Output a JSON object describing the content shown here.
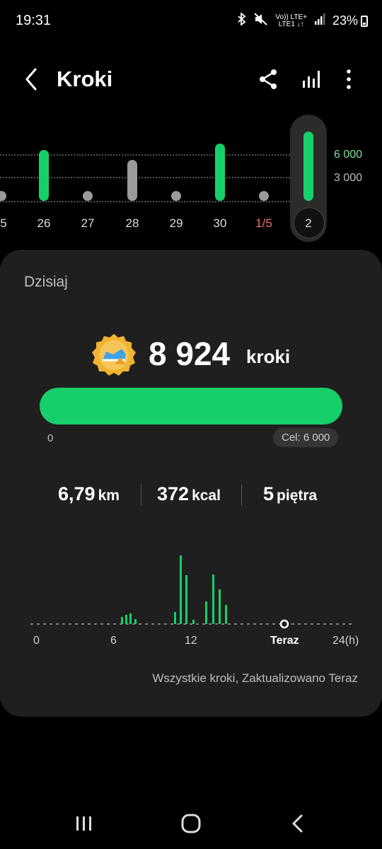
{
  "status_bar": {
    "time": "19:31",
    "network_top": "Vo)) LTE+",
    "network_bottom": "LTE1 ↓↑",
    "battery": "23%"
  },
  "header": {
    "title": "Kroki",
    "icons": [
      "back-icon",
      "share-icon",
      "bar-chart-icon",
      "more-icon"
    ]
  },
  "daily_chart": {
    "y_ticks": [
      "6 000",
      "3 000"
    ],
    "days": [
      "5",
      "26",
      "27",
      "28",
      "29",
      "30",
      "1/5",
      "2"
    ],
    "colors": {
      "goal_met": "#17cf6a",
      "below_goal": "#9a9a9a",
      "accent_red": "#f07070"
    }
  },
  "today": {
    "title": "Dzisiaj",
    "steps": "8 924",
    "steps_unit": "kroki",
    "progress_fraction": 1.0,
    "progress_min": "0",
    "goal": "Cel: 6 000",
    "distance_value": "6,79",
    "distance_unit": "km",
    "calories_value": "372",
    "calories_unit": "kcal",
    "floors_value": "5",
    "floors_unit": "piętra",
    "hour_labels": [
      "0",
      "6",
      "12",
      "Teraz",
      "24(h)"
    ],
    "updated_text": "Wszystkie kroki, Zaktualizowano Teraz"
  },
  "nav": {
    "icons": [
      "recent-apps-icon",
      "home-icon",
      "back-nav-icon"
    ]
  }
}
